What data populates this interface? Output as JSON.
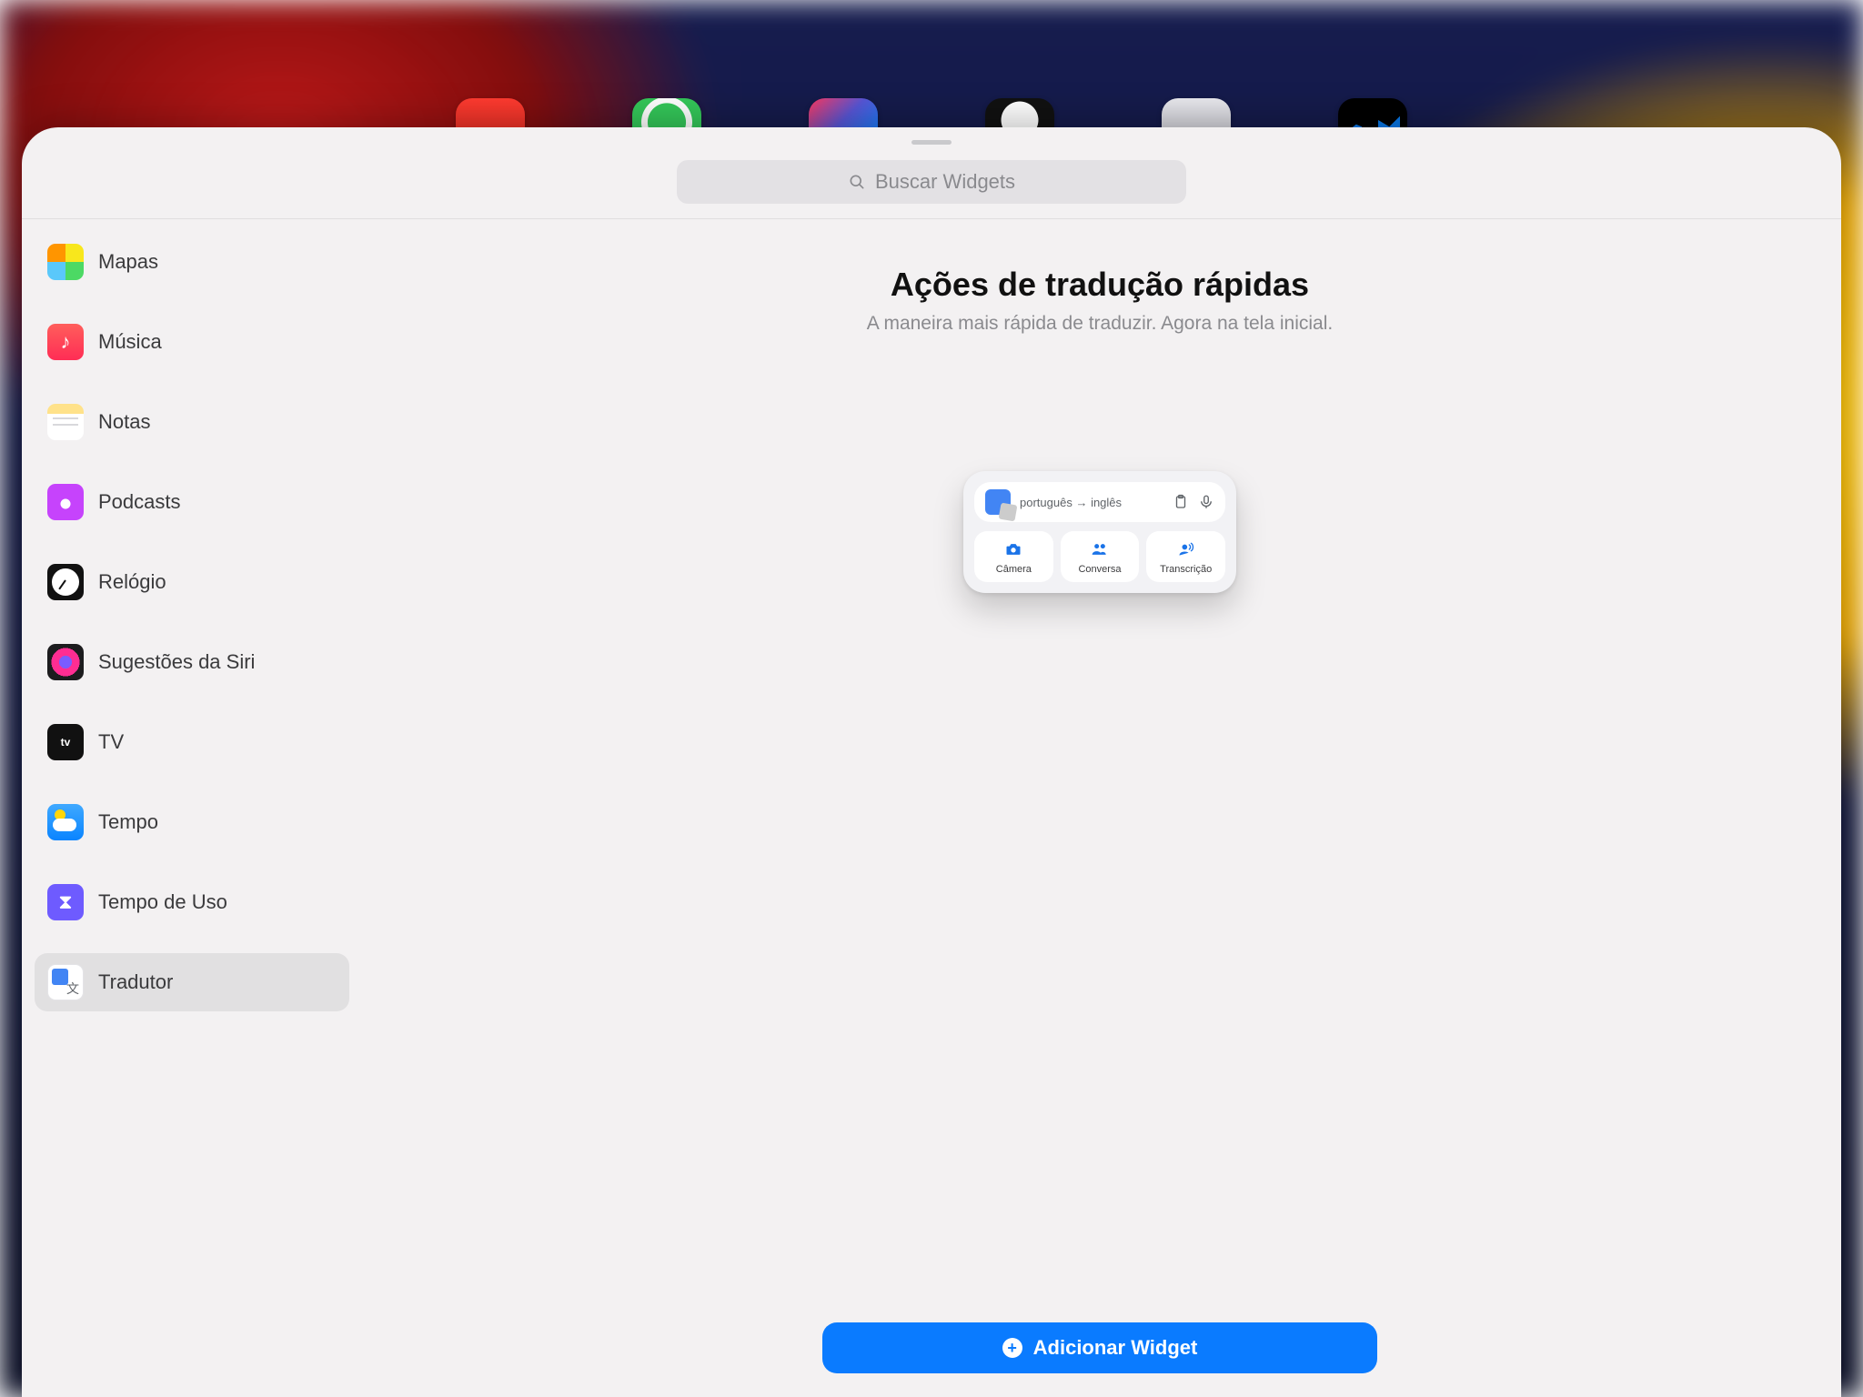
{
  "search": {
    "placeholder": "Buscar Widgets"
  },
  "sidebar": {
    "items": [
      {
        "label": "Mapas"
      },
      {
        "label": "Música"
      },
      {
        "label": "Notas"
      },
      {
        "label": "Podcasts"
      },
      {
        "label": "Relógio"
      },
      {
        "label": "Sugestões da Siri"
      },
      {
        "label": "TV"
      },
      {
        "label": "Tempo"
      },
      {
        "label": "Tempo de Uso"
      },
      {
        "label": "Tradutor"
      }
    ],
    "selected_index": 9
  },
  "main": {
    "title": "Ações de tradução rápidas",
    "subtitle": "A maneira mais rápida de traduzir. Agora na tela inicial.",
    "add_button_label": "Adicionar Widget"
  },
  "widget_preview": {
    "lang_from": "português",
    "lang_to": "inglês",
    "tiles": [
      {
        "label": "Câmera"
      },
      {
        "label": "Conversa"
      },
      {
        "label": "Transcrição"
      }
    ]
  },
  "tv_icon_text": "tv"
}
